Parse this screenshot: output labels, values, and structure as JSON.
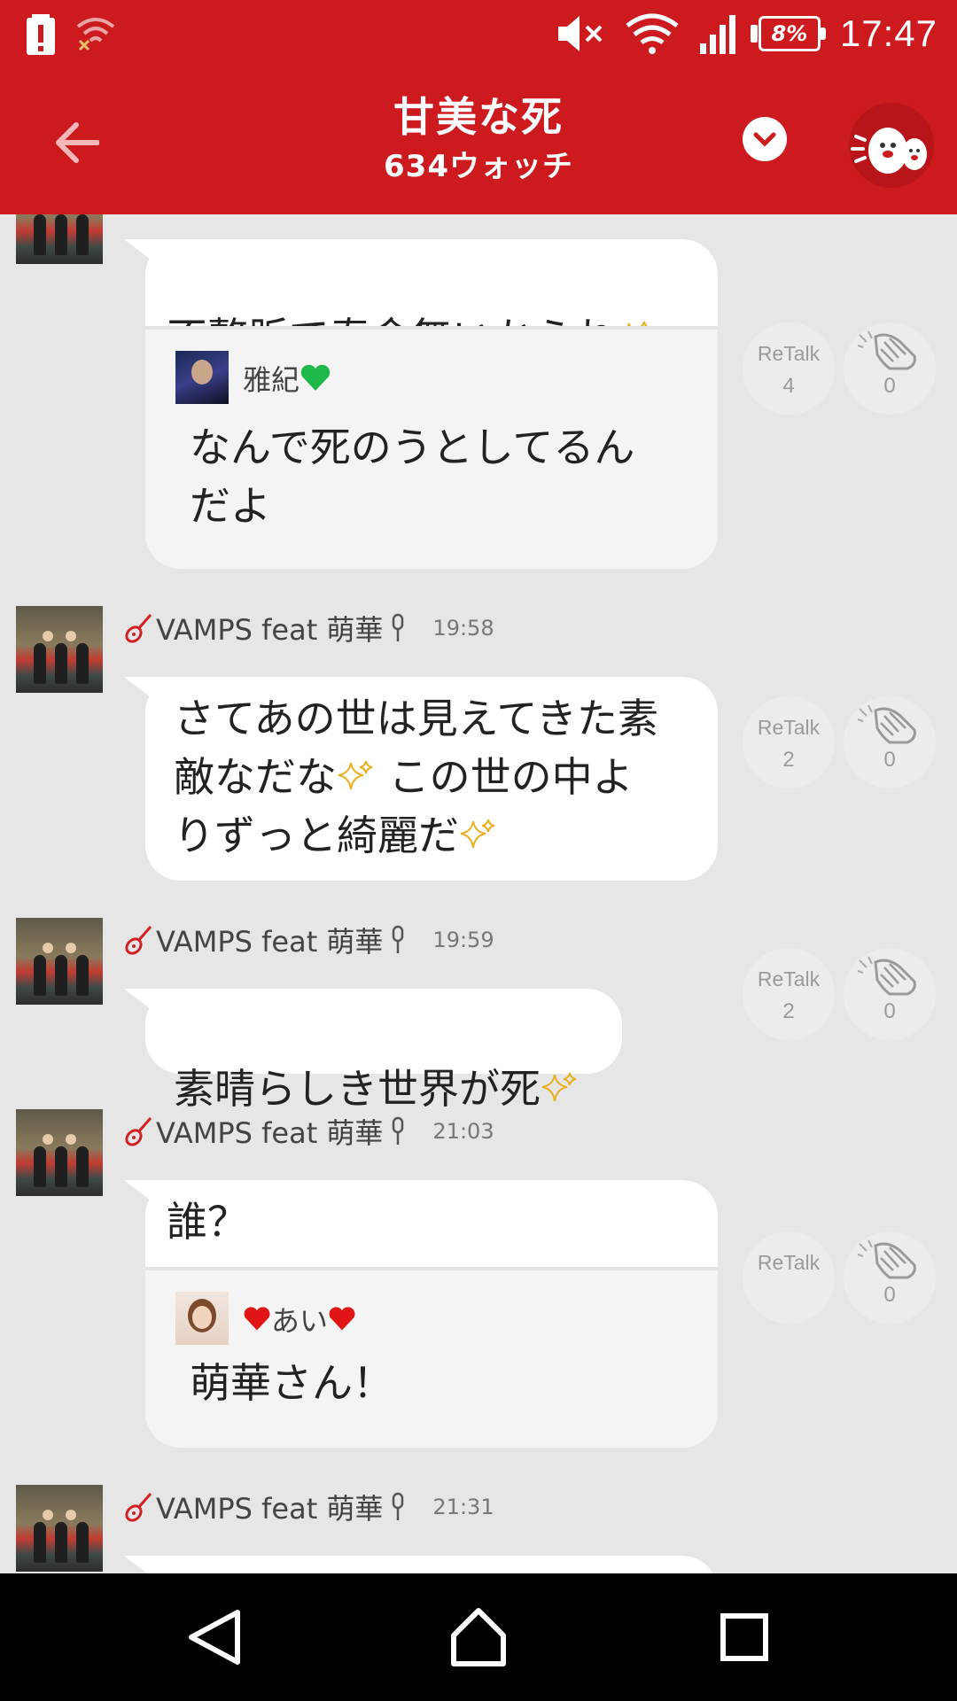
{
  "status_bar": {
    "time": "17:47",
    "battery": "8%",
    "icons": [
      "alert-icon",
      "wifi-off-icon",
      "mute-icon",
      "wifi-icon",
      "signal-icon",
      "battery-icon"
    ]
  },
  "header": {
    "title": "甘美な死",
    "subtitle": "634ウォッチ",
    "colors": {
      "brand": "#cc1a1f"
    }
  },
  "messages": [
    {
      "text": "不整脈で寿命無いからね",
      "quote": {
        "name": "雅紀",
        "text": "なんで死のうとしてるん\nだよ"
      },
      "retalk_label": "ReTalk",
      "retalk_count": "4",
      "clap_count": "0"
    },
    {
      "author": "VAMPS feat 萌華",
      "time": "19:58",
      "text_lines": [
        "さてあの世は見えてきた素",
        "敵なだな",
        " この世の中よ",
        "りずっと綺麗だ"
      ],
      "retalk_label": "ReTalk",
      "retalk_count": "2",
      "clap_count": "0"
    },
    {
      "author": "VAMPS feat 萌華",
      "time": "19:59",
      "text": "素晴らしき世界が死",
      "retalk_label": "ReTalk",
      "retalk_count": "2",
      "clap_count": "0"
    },
    {
      "author": "VAMPS feat 萌華",
      "time": "21:03",
      "text": "誰？",
      "quote": {
        "name": "あい",
        "text": "萌華さん！"
      },
      "retalk_label": "ReTalk",
      "clap_count": "0"
    },
    {
      "author": "VAMPS feat 萌華",
      "time": "21:31"
    }
  ],
  "nav_bar": {
    "icons": [
      "back-triangle-icon",
      "home-icon",
      "recents-icon"
    ]
  }
}
